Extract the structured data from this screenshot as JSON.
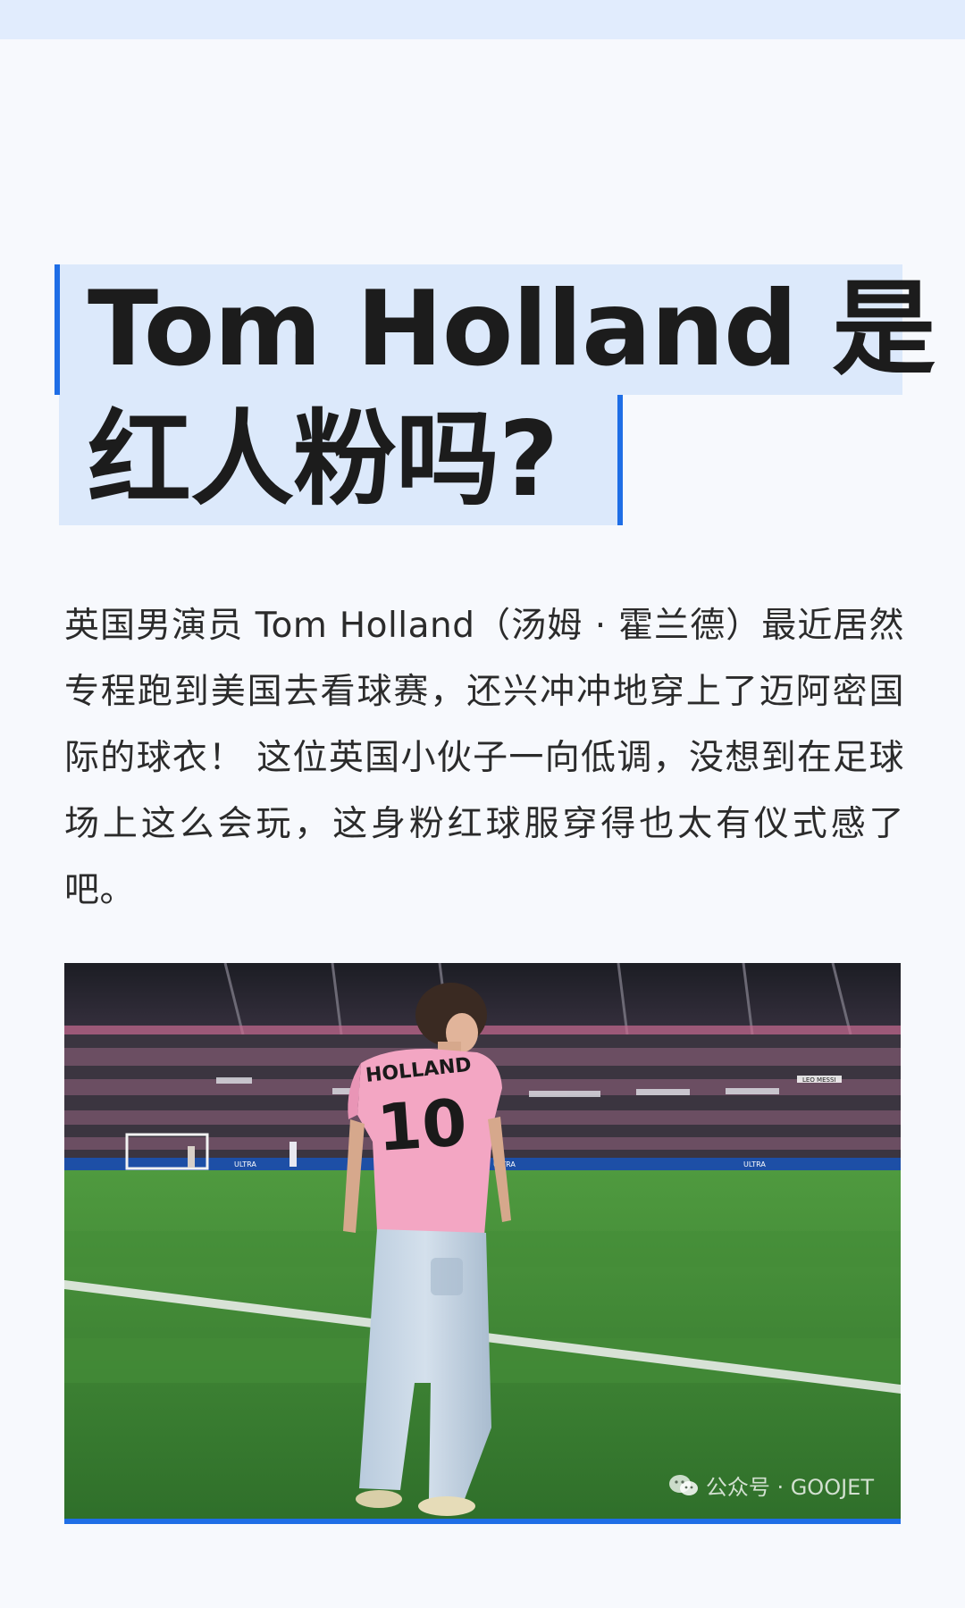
{
  "article": {
    "title_line1": "Tom Holland 是",
    "title_line2": "红人粉吗?",
    "body": "英国男演员 Tom Holland（汤姆 · 霍兰德）最近居然专程跑到美国去看球赛，还兴冲冲地穿上了迈阿密国际的球衣！ 这位英国小伙子一向低调，没想到在足球场上这么会玩，这身粉红球服穿得也太有仪式感了吧。"
  },
  "photo": {
    "jersey_name": "HOLLAND",
    "jersey_number": "10",
    "board_text": "LEO MESSI",
    "ad_text": "ULTRA",
    "watermark": "公众号 · GOOJET"
  },
  "colors": {
    "accent": "#1f6ee6",
    "heading_bg": "#dce9fb",
    "jersey_pink": "#f3a6c3",
    "pitch_green": "#3f8a35"
  }
}
